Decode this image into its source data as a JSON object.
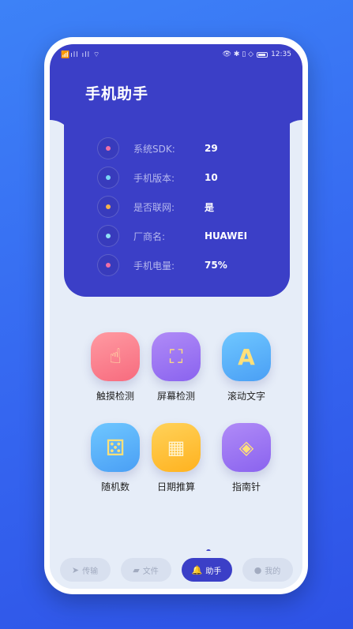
{
  "status_bar": {
    "left_indicators": "📶ıll ıll ⌔",
    "right_icons": "👁 ✱ ▯ ◇",
    "time": "12:35"
  },
  "header": {
    "title": "手机助手"
  },
  "info": {
    "rows": [
      {
        "label": "系统SDK:",
        "value": "29",
        "dot_color": "#f06fa6"
      },
      {
        "label": "手机版本:",
        "value": "10",
        "dot_color": "#79d6f5"
      },
      {
        "label": "是否联网:",
        "value": "是",
        "dot_color": "#f5b24a"
      },
      {
        "label": "厂商名:",
        "value": "HUAWEI",
        "dot_color": "#8fe0f5"
      },
      {
        "label": "手机电量:",
        "value": "75%",
        "dot_color": "#f06fa6"
      }
    ]
  },
  "tools": [
    {
      "label": "触摸检测",
      "icon": "hand-tap-icon",
      "glyph": "☝",
      "color_top": "#ff9aa2",
      "color_bottom": "#f76b7e"
    },
    {
      "label": "屏幕检测",
      "icon": "screen-frame-icon",
      "glyph": "⛶",
      "color_top": "#b08bf7",
      "color_bottom": "#8a63ef"
    },
    {
      "label": "滚动文字",
      "icon": "letter-a-icon",
      "glyph": "A",
      "color_top": "#6fc7ff",
      "color_bottom": "#4a9ff5"
    },
    {
      "label": "随机数",
      "icon": "dice-icon",
      "glyph": "⚄",
      "color_top": "#6fc7ff",
      "color_bottom": "#4a9ff5"
    },
    {
      "label": "日期推算",
      "icon": "calendar-icon",
      "glyph": "▦",
      "color_top": "#ffd25a",
      "color_bottom": "#ffb21f"
    },
    {
      "label": "指南针",
      "icon": "compass-icon",
      "glyph": "◈",
      "color_top": "#b08bf7",
      "color_bottom": "#8a63ef"
    }
  ],
  "nav": {
    "items": [
      {
        "label": "传输",
        "icon": "send-icon",
        "glyph": "➤",
        "active": false
      },
      {
        "label": "文件",
        "icon": "folder-icon",
        "glyph": "▰",
        "active": false
      },
      {
        "label": "助手",
        "icon": "bell-icon",
        "glyph": "🔔",
        "active": true
      },
      {
        "label": "我的",
        "icon": "user-icon",
        "glyph": "●",
        "active": false
      }
    ]
  }
}
